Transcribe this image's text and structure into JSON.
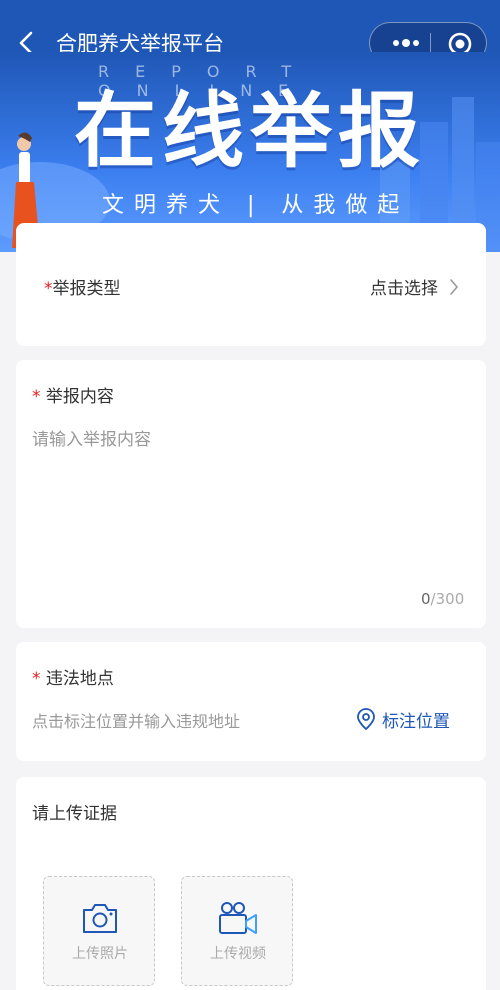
{
  "nav": {
    "title": "合肥养犬举报平台"
  },
  "banner": {
    "kicker": "REPORT ONLINE",
    "headline": "在线举报",
    "slogan": "文明养犬 | 从我做起"
  },
  "form": {
    "report_type": {
      "required_mark": "*",
      "label": "举报类型",
      "action": "点击选择"
    },
    "content": {
      "required_mark": "*",
      "label": "举报内容",
      "placeholder": "请输入举报内容",
      "count": "0",
      "max": "/300"
    },
    "location": {
      "required_mark": "*",
      "label": "违法地点",
      "placeholder": "点击标注位置并输入违规地址",
      "action": "标注位置"
    },
    "evidence": {
      "label": "请上传证据",
      "photo": "上传照片",
      "video": "上传视频"
    }
  },
  "colors": {
    "primary": "#1f57b6",
    "required": "#e02020",
    "page_bg": "#f4f4f6"
  },
  "icons": [
    "back-arrow-icon",
    "more-dots-icon",
    "target-icon",
    "chevron-right-icon",
    "location-pin-icon",
    "camera-icon",
    "video-camera-icon"
  ]
}
